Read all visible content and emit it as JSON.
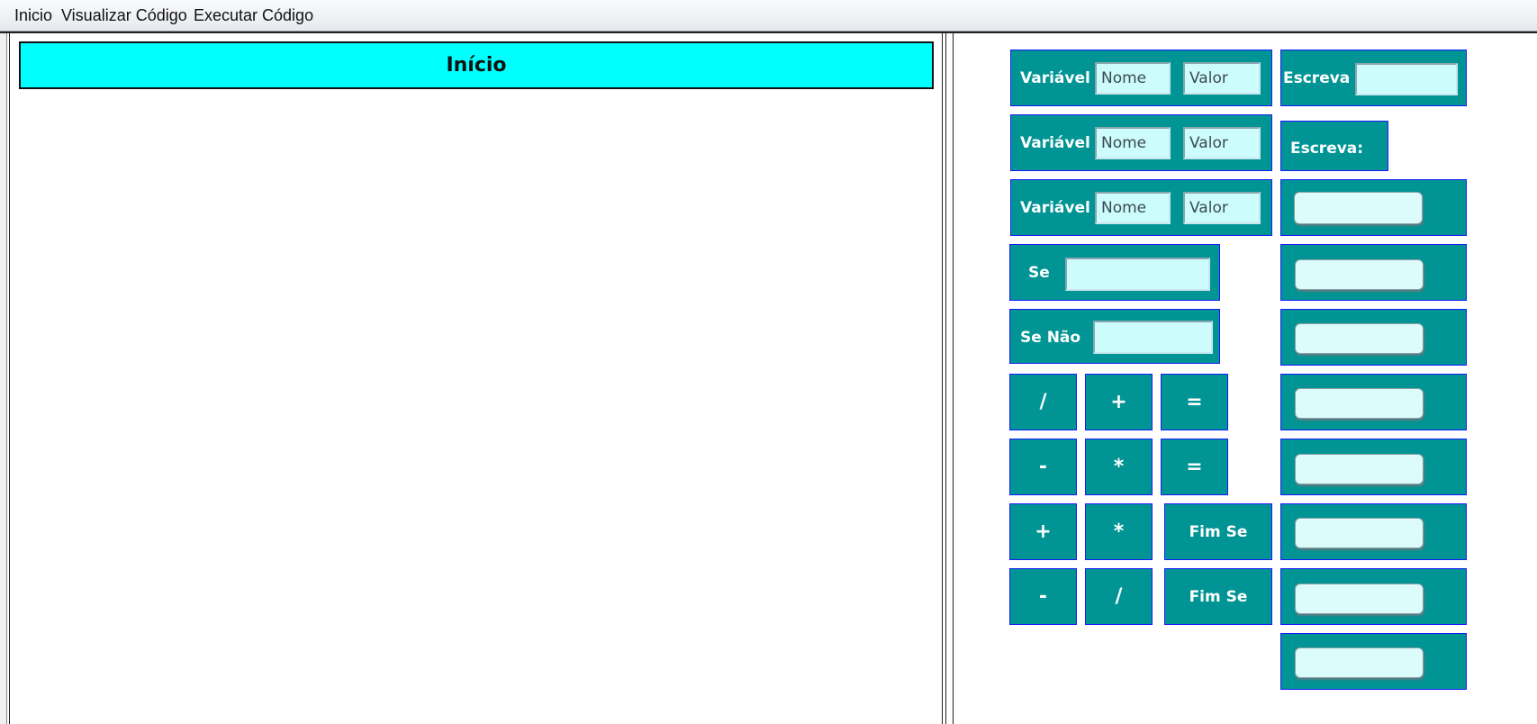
{
  "menu": {
    "inicio": "Inicio",
    "visualizar": "Visualizar Código",
    "executar": "Executar Código"
  },
  "canvas": {
    "start_block": "Início"
  },
  "palette": {
    "variavel_label": "Variável",
    "nome_placeholder": "Nome",
    "valor_placeholder": "Valor",
    "escreva_label": "Escreva",
    "escreva2_label": "Escreva:",
    "se_label": "Se",
    "senao_label": "Se Não",
    "fim_se_label": "Fim Se",
    "operators": {
      "row1": [
        "/",
        "+",
        "="
      ],
      "row2": [
        "-",
        "*",
        "="
      ],
      "row3": [
        "+",
        "*"
      ],
      "row4": [
        "-",
        "/"
      ]
    }
  },
  "colors": {
    "block_bg": "#009494",
    "block_border": "#1a1aff",
    "input_bg": "#ccfcfc",
    "start_bg": "#00ffff"
  }
}
